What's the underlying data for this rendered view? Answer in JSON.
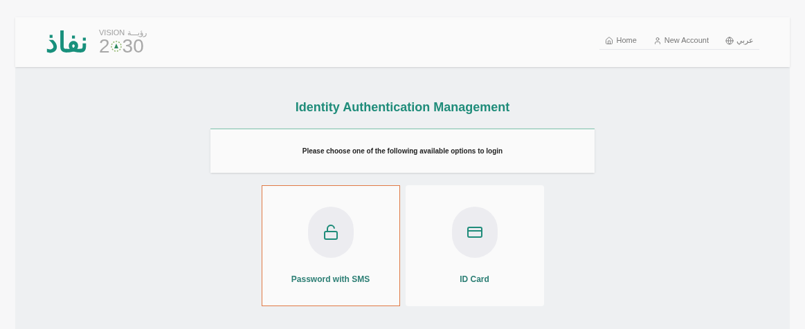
{
  "header": {
    "logo": "نفاذ",
    "vision": {
      "label": "VISION",
      "arabic": "رؤيـــة",
      "year_start": "2",
      "year_end": "30"
    },
    "nav": [
      {
        "kind": "home",
        "label": "Home"
      },
      {
        "kind": "account",
        "label": "New Account"
      },
      {
        "kind": "language",
        "label": "عربي"
      }
    ]
  },
  "title": "Identity Authentication Management",
  "instruction": "Please choose one of the following available options to login",
  "options": [
    {
      "kind": "password",
      "label": "Password with SMS",
      "selected": true
    },
    {
      "kind": "card",
      "label": "ID Card",
      "selected": false
    }
  ]
}
